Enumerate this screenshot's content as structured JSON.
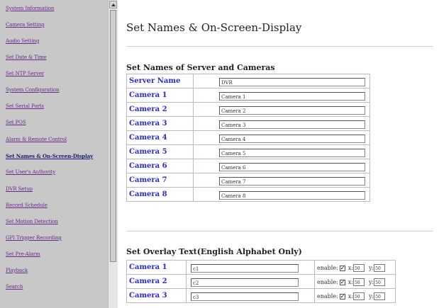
{
  "sidebar": {
    "items": [
      {
        "label": "System Information",
        "active": false
      },
      {
        "label": "Camera Setting",
        "active": false
      },
      {
        "label": "Audio Setting",
        "active": false
      },
      {
        "label": "Set Date & Time",
        "active": false
      },
      {
        "label": "Set NTP Server",
        "active": false
      },
      {
        "label": "System Configuration",
        "active": false
      },
      {
        "label": "Set Serial Ports",
        "active": false
      },
      {
        "label": "Set POS",
        "active": false
      },
      {
        "label": "Alarm & Remote Control",
        "active": false
      },
      {
        "label": "Set Names & On-Screen-Display",
        "active": true
      },
      {
        "label": "Set User's Authority",
        "active": false
      },
      {
        "label": "DVR Setup",
        "active": false
      },
      {
        "label": "Record Schedule",
        "active": false
      },
      {
        "label": "Set Motion Detection",
        "active": false
      },
      {
        "label": "GPI Trigger Recording",
        "active": false
      },
      {
        "label": "Set Pre-Alarm",
        "active": false
      },
      {
        "label": "Playback",
        "active": false
      },
      {
        "label": "Search",
        "active": false
      }
    ]
  },
  "main": {
    "title": "Set Names & On-Screen-Display",
    "names_section": {
      "title": "Set Names of Server and Cameras",
      "rows": [
        {
          "label": "Server Name",
          "value": "DVR"
        },
        {
          "label": "Camera 1",
          "value": "Camera 1"
        },
        {
          "label": "Camera 2",
          "value": "Camera 2"
        },
        {
          "label": "Camera 3",
          "value": "Camera 3"
        },
        {
          "label": "Camera 4",
          "value": "Camera 4"
        },
        {
          "label": "Camera 5",
          "value": "Camera 5"
        },
        {
          "label": "Camera 6",
          "value": "Camera 6"
        },
        {
          "label": "Camera 7",
          "value": "Camera 7"
        },
        {
          "label": "Camera 8",
          "value": "Camera 8"
        }
      ]
    },
    "overlay_section": {
      "title": "Set Overlay Text(English Alphabet Only)",
      "enable_label": "enable:",
      "x_label": "x:",
      "y_label": "y:",
      "check_mark": "✓",
      "rows": [
        {
          "label": "Camera 1",
          "text": "c1",
          "enabled": true,
          "x": "50",
          "y": "50"
        },
        {
          "label": "Camera 2",
          "text": "c2",
          "enabled": true,
          "x": "50",
          "y": "50"
        },
        {
          "label": "Camera 3",
          "text": "c3",
          "enabled": true,
          "x": "50",
          "y": "50"
        }
      ]
    }
  }
}
